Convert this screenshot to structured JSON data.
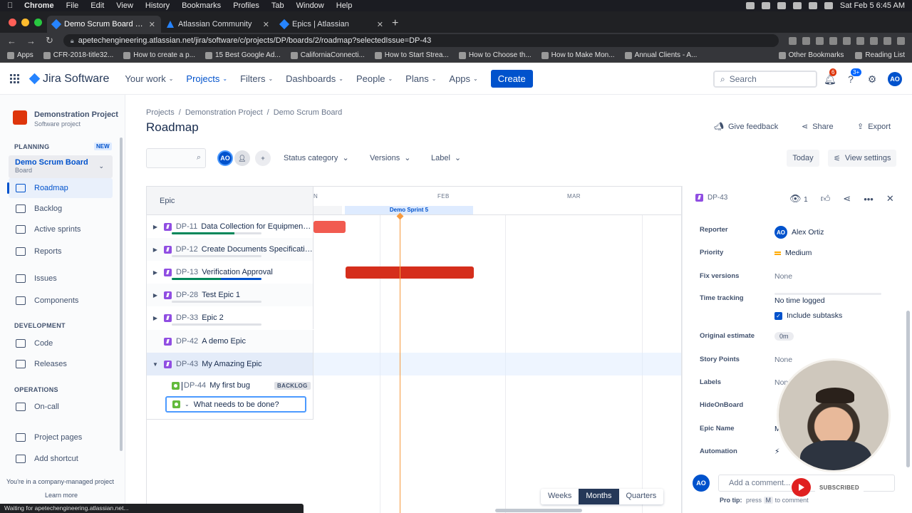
{
  "mac_menubar": {
    "app": "Chrome",
    "menus": [
      "File",
      "Edit",
      "View",
      "History",
      "Bookmarks",
      "Profiles",
      "Tab",
      "Window",
      "Help"
    ],
    "clock": "Sat Feb 5  6:45 AM"
  },
  "browser": {
    "tabs": [
      {
        "title": "Demo Scrum Board - Roadmap",
        "active": true
      },
      {
        "title": "Atlassian Community",
        "active": false
      },
      {
        "title": "Epics | Atlassian",
        "active": false
      }
    ],
    "url": "apetechengineering.atlassian.net/jira/software/c/projects/DP/boards/2/roadmap?selectedIssue=DP-43",
    "bookmarks": [
      "Apps",
      "CFR-2018-title32...",
      "How to create a p...",
      "15 Best Google Ad...",
      "CaliforniaConnecti...",
      "How to Start Strea...",
      "How to Choose th...",
      "How to Make Mon...",
      "Annual Clients - A..."
    ],
    "bookmarks_right": [
      "Other Bookmarks",
      "Reading List"
    ],
    "status_text": "Waiting for apetechengineering.atlassian.net..."
  },
  "topnav": {
    "product": "Jira Software",
    "items": [
      "Your work",
      "Projects",
      "Filters",
      "Dashboards",
      "People",
      "Plans",
      "Apps"
    ],
    "create_label": "Create",
    "search_placeholder": "Search",
    "notification_count": "6",
    "help_count": "3+",
    "user_initials": "AO"
  },
  "sidebar": {
    "project_name": "Demonstration Project",
    "project_type": "Software project",
    "planning_label": "PLANNING",
    "new_tag": "NEW",
    "board_name": "Demo Scrum Board",
    "board_sub": "Board",
    "planning_items": [
      "Roadmap",
      "Backlog",
      "Active sprints",
      "Reports"
    ],
    "other_items": [
      "Issues",
      "Components"
    ],
    "development_label": "DEVELOPMENT",
    "development_items": [
      "Code",
      "Releases"
    ],
    "operations_label": "OPERATIONS",
    "operations_items": [
      "On-call"
    ],
    "bottom_items": [
      "Project pages",
      "Add shortcut"
    ],
    "footer": "You're in a company-managed project",
    "learn_more": "Learn more"
  },
  "main": {
    "breadcrumb": [
      "Projects",
      "Demonstration Project",
      "Demo Scrum Board"
    ],
    "title": "Roadmap",
    "give_feedback": "Give feedback",
    "share": "Share",
    "export": "Export",
    "avatar_initials": "AO",
    "filters": [
      "Status category",
      "Versions",
      "Label"
    ],
    "today": "Today",
    "view_settings": "View settings"
  },
  "roadmap": {
    "epic_header": "Epic",
    "months": [
      "N",
      "FEB",
      "MAR"
    ],
    "sprint": "Demo Sprint 5",
    "epics": [
      {
        "key": "DP-11",
        "title": "Data Collection for Equipment ...",
        "expanded": false,
        "progress_done": 0.7,
        "progress_inprogress": 0.0
      },
      {
        "key": "DP-12",
        "title": "Create Documents Specificatio...",
        "expanded": false,
        "progress_done": 0.0,
        "progress_inprogress": 0.0
      },
      {
        "key": "DP-13",
        "title": "Verification Approval",
        "expanded": false,
        "progress_done": 0.55,
        "progress_inprogress": 0.45
      },
      {
        "key": "DP-28",
        "title": "Test Epic 1",
        "expanded": false,
        "progress_done": 0.0,
        "progress_inprogress": 0.0
      },
      {
        "key": "DP-33",
        "title": "Epic 2",
        "expanded": false,
        "progress_done": 0.0,
        "progress_inprogress": 0.0
      },
      {
        "key": "DP-42",
        "title": "A demo Epic",
        "expanded": false,
        "progress_done": 0.0,
        "progress_inprogress": 0.0
      },
      {
        "key": "DP-43",
        "title": "My Amazing Epic",
        "expanded": true,
        "progress_done": 0.0,
        "progress_inprogress": 0.0
      }
    ],
    "bars": [
      {
        "epic": "DP-11",
        "color": "#f15b50"
      },
      {
        "epic": "DP-13",
        "color": "#d52e1c"
      }
    ],
    "child": {
      "key": "DP-44",
      "title": "My first bug",
      "status": "BACKLOG"
    },
    "new_issue_placeholder": "What needs to be done?",
    "timescale": [
      "Weeks",
      "Months",
      "Quarters"
    ],
    "timescale_active": "Months"
  },
  "detail": {
    "issue_key": "DP-43",
    "watchers": "1",
    "fields": [
      {
        "label": "Reporter",
        "value": "Alex Ortiz"
      },
      {
        "label": "Priority",
        "value": "Medium"
      },
      {
        "label": "Fix versions",
        "value": "None"
      },
      {
        "label": "Time tracking",
        "value": "No time logged"
      },
      {
        "label": "Include subtasks",
        "value": ""
      },
      {
        "label": "Original estimate",
        "value": "0m"
      },
      {
        "label": "Story Points",
        "value": "None"
      },
      {
        "label": "Labels",
        "value": "None"
      },
      {
        "label": "HideOnBoard",
        "value": ""
      },
      {
        "label": "Epic Name",
        "value": "M"
      },
      {
        "label": "Automation",
        "value": ""
      }
    ],
    "include_subtasks": "Include subtasks",
    "comment_placeholder": "Add a comment...",
    "protip_a": "Pro tip:",
    "protip_b": "press",
    "protip_key": "M",
    "protip_c": "to comment"
  },
  "overlay": {
    "subscribed": "SUBSCRIBED"
  }
}
